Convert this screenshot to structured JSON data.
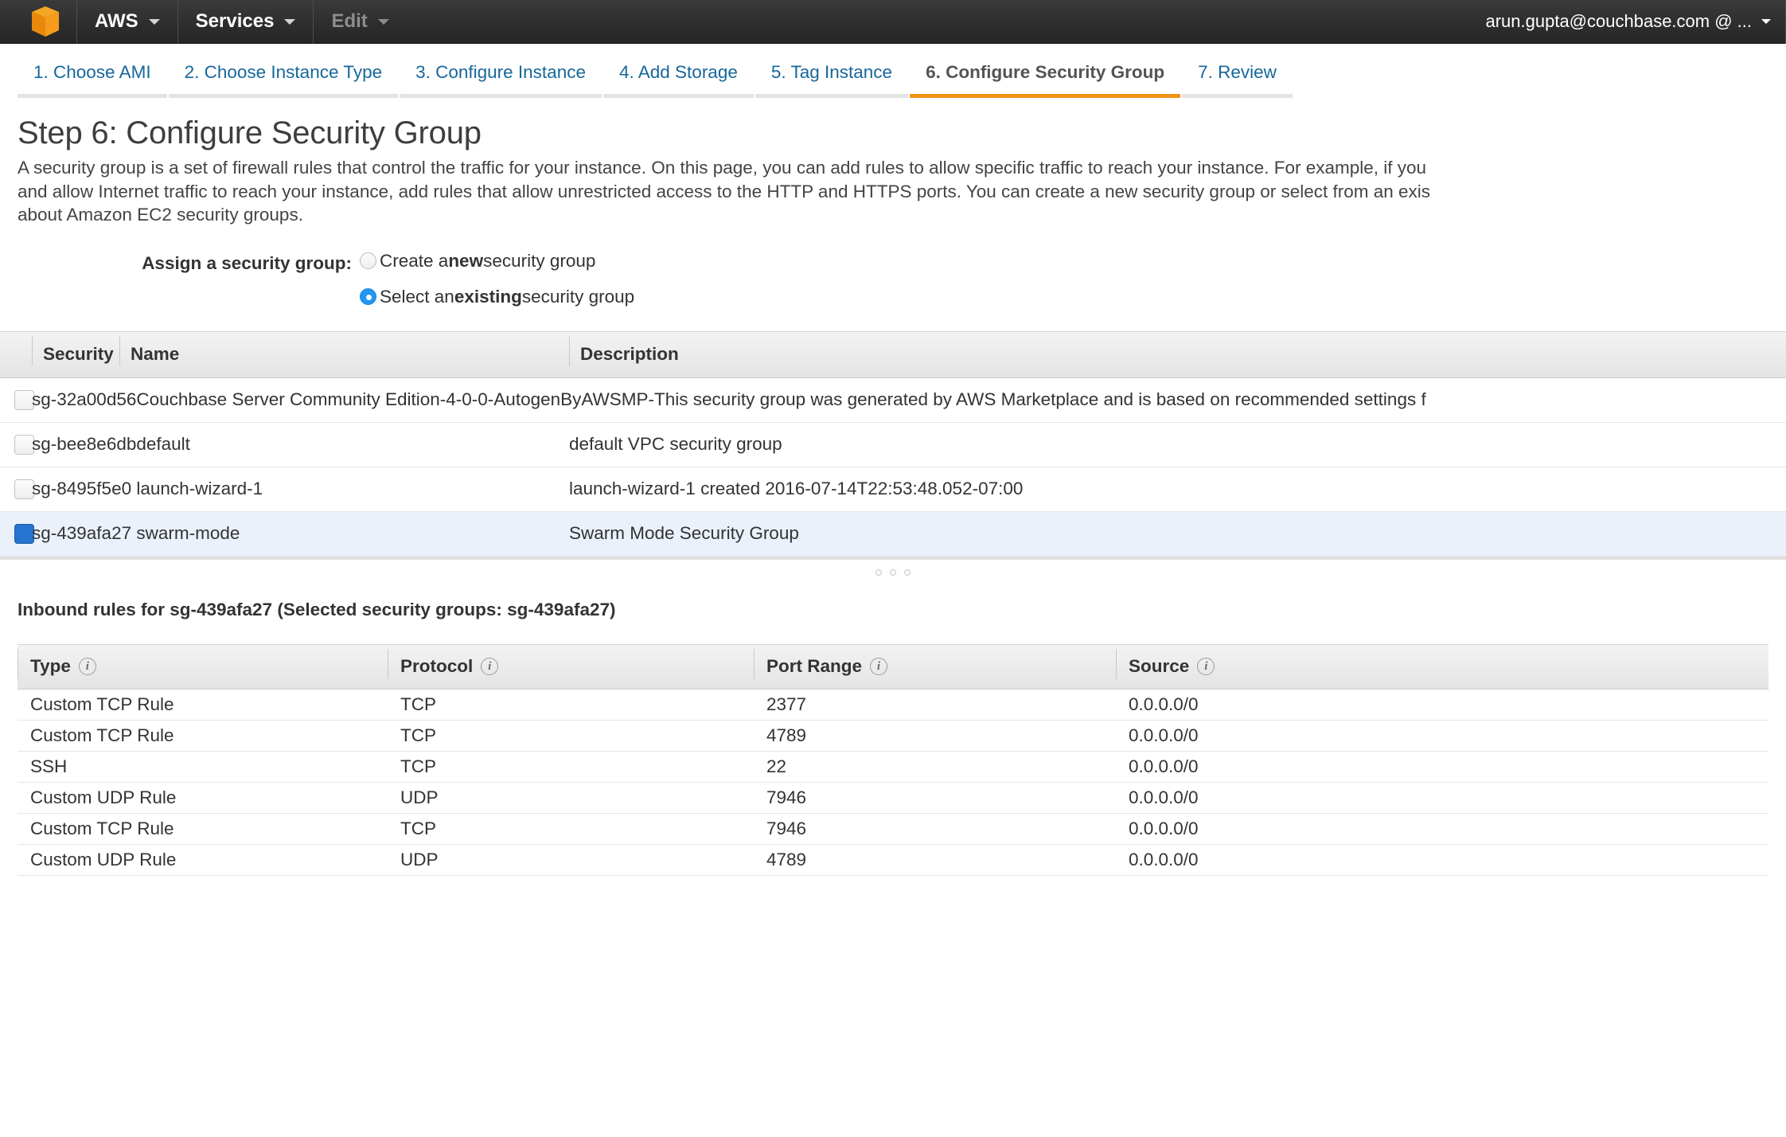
{
  "console": {
    "logo_name": "aws-cube-logo",
    "menus": [
      {
        "label": "AWS",
        "dim": false
      },
      {
        "label": "Services",
        "dim": false
      },
      {
        "label": "Edit",
        "dim": true
      }
    ],
    "account": "arun.gupta@couchbase.com @ ..."
  },
  "wizard": {
    "tabs": [
      {
        "label": "1. Choose AMI",
        "active": false
      },
      {
        "label": "2. Choose Instance Type",
        "active": false
      },
      {
        "label": "3. Configure Instance",
        "active": false
      },
      {
        "label": "4. Add Storage",
        "active": false
      },
      {
        "label": "5. Tag Instance",
        "active": false
      },
      {
        "label": "6. Configure Security Group",
        "active": true
      },
      {
        "label": "7. Review",
        "active": false
      }
    ],
    "active_accent": "#f09215",
    "link_color": "#16679a"
  },
  "page": {
    "title": "Step 6: Configure Security Group",
    "description_line1": "A security group is a set of firewall rules that control the traffic for your instance. On this page, you can add rules to allow specific traffic to reach your instance. For example, if you",
    "description_line2": "and allow Internet traffic to reach your instance, add rules that allow unrestricted access to the HTTP and HTTPS ports. You can create a new security group or select from an exis",
    "description_line3": "about Amazon EC2 security groups."
  },
  "assign": {
    "label": "Assign a security group:",
    "options": [
      {
        "pre": "Create a ",
        "bold": "new",
        "post": " security group",
        "selected": false
      },
      {
        "pre": "Select an ",
        "bold": "existing",
        "post": " security group",
        "selected": true
      }
    ]
  },
  "sg_table": {
    "headers": {
      "security": "Security",
      "name": "Name",
      "description": "Description"
    },
    "rows": [
      {
        "name": "sg-32a00d56Couchbase Server Community Edition-4-0-0-AutogenByAWSMP-This security group was generated by AWS Marketplace and is based on recommended settings f",
        "description": "",
        "checked": false,
        "selected": false,
        "wide": true
      },
      {
        "name": "sg-bee8e6dbdefault",
        "description": "default VPC security group",
        "checked": false,
        "selected": false,
        "wide": false
      },
      {
        "name": "sg-8495f5e0 launch-wizard-1",
        "description": "launch-wizard-1 created 2016-07-14T22:53:48.052-07:00",
        "checked": false,
        "selected": false,
        "wide": false
      },
      {
        "name": "sg-439afa27 swarm-mode",
        "description": "Swarm Mode Security Group",
        "checked": true,
        "selected": true,
        "wide": false
      }
    ]
  },
  "inbound": {
    "title": "Inbound rules for sg-439afa27 (Selected security groups: sg-439afa27)",
    "headers": {
      "type": "Type",
      "protocol": "Protocol",
      "port_range": "Port Range",
      "source": "Source"
    },
    "rows": [
      {
        "type": "Custom TCP Rule",
        "protocol": "TCP",
        "port_range": "2377",
        "source": "0.0.0.0/0"
      },
      {
        "type": "Custom TCP Rule",
        "protocol": "TCP",
        "port_range": "4789",
        "source": "0.0.0.0/0"
      },
      {
        "type": "SSH",
        "protocol": "TCP",
        "port_range": "22",
        "source": "0.0.0.0/0"
      },
      {
        "type": "Custom UDP Rule",
        "protocol": "UDP",
        "port_range": "7946",
        "source": "0.0.0.0/0"
      },
      {
        "type": "Custom TCP Rule",
        "protocol": "TCP",
        "port_range": "7946",
        "source": "0.0.0.0/0"
      },
      {
        "type": "Custom UDP Rule",
        "protocol": "UDP",
        "port_range": "4789",
        "source": "0.0.0.0/0"
      }
    ]
  }
}
